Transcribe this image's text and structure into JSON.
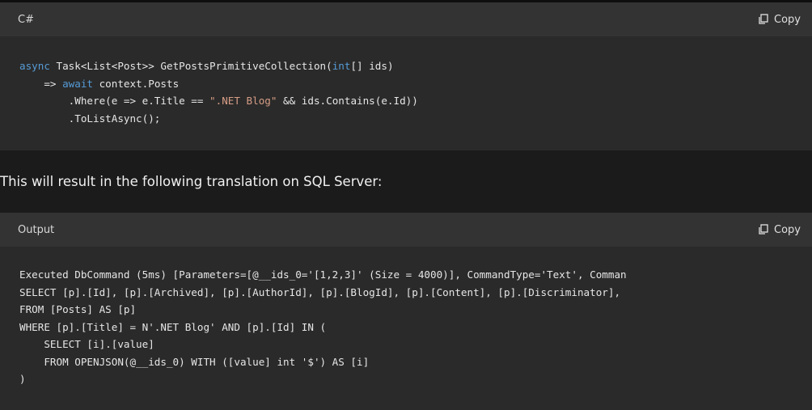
{
  "block1": {
    "language": "C#",
    "copy_label": "Copy",
    "code": {
      "l1_kw1": "async",
      "l1_rest": " Task<List<Post>> GetPostsPrimitiveCollection(",
      "l1_kw2": "int",
      "l1_end": "[] ids)",
      "l2_pre": "    => ",
      "l2_kw": "await",
      "l2_rest": " context.Posts",
      "l3_pre": "        .Where(e => e.Title == ",
      "l3_str": "\".NET Blog\"",
      "l3_rest": " && ids.Contains(e.Id))",
      "l4": "        .ToListAsync();"
    }
  },
  "prose": "This will result in the following translation on SQL Server:",
  "block2": {
    "language": "Output",
    "copy_label": "Copy",
    "lines": [
      "Executed DbCommand (5ms) [Parameters=[@__ids_0='[1,2,3]' (Size = 4000)], CommandType='Text', Comman",
      "SELECT [p].[Id], [p].[Archived], [p].[AuthorId], [p].[BlogId], [p].[Content], [p].[Discriminator],",
      "FROM [Posts] AS [p]",
      "WHERE [p].[Title] = N'.NET Blog' AND [p].[Id] IN (",
      "    SELECT [i].[value]",
      "    FROM OPENJSON(@__ids_0) WITH ([value] int '$') AS [i]",
      ")"
    ]
  },
  "colors": {
    "keyword": "#569cd6",
    "string": "#d69d85",
    "code_bg": "#2a2a2a",
    "header_bg": "#333333",
    "page_bg": "#1b1b1b"
  }
}
